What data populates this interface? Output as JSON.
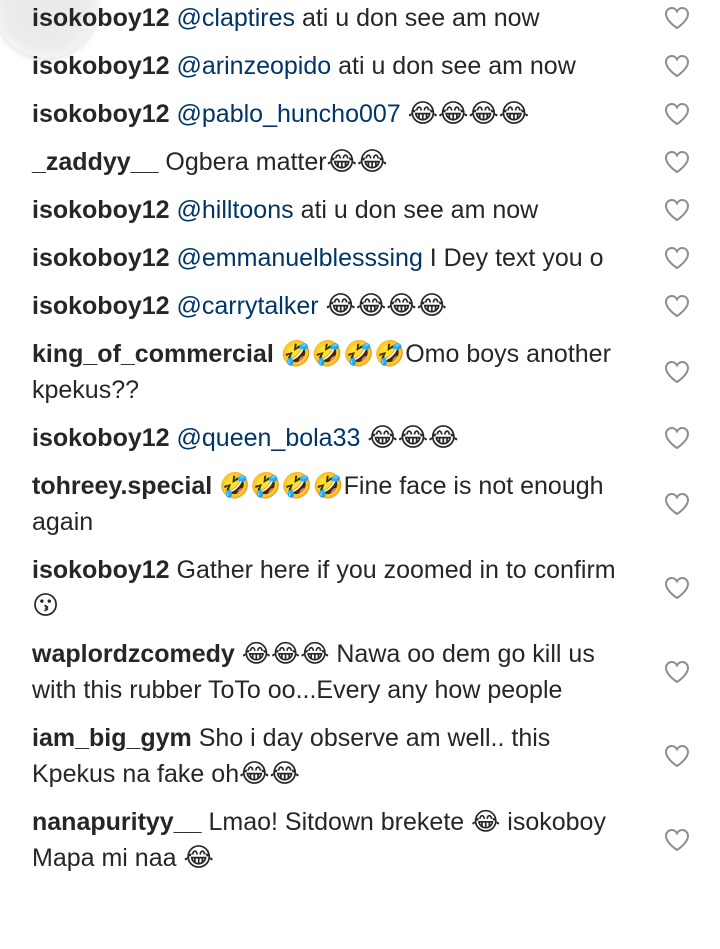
{
  "comments": [
    {
      "user": "isokoboy12",
      "mention": "@claptires",
      "text": " ati u don see am now",
      "emoji": ""
    },
    {
      "user": "isokoboy12",
      "mention": "@arinzeopido",
      "text": " ati u don see am now",
      "emoji": ""
    },
    {
      "user": "isokoboy12",
      "mention": "@pablo_huncho007",
      "text": " ",
      "emoji": "😂😂😂😂"
    },
    {
      "user": "_zaddyy__",
      "mention": "",
      "text": "Ogbera matter",
      "emoji": "😂😂"
    },
    {
      "user": "isokoboy12",
      "mention": "@hilltoons",
      "text": " ati u don see am now",
      "emoji": ""
    },
    {
      "user": "isokoboy12",
      "mention": "@emmanuelblesssing",
      "text": " I Dey text you o",
      "emoji": ""
    },
    {
      "user": "isokoboy12",
      "mention": "@carrytalker",
      "text": " ",
      "emoji": "😂😂😂😂"
    },
    {
      "user": "king_of_commercial",
      "mention": "",
      "text": "🤣🤣🤣🤣Omo boys another kpekus??",
      "emoji": ""
    },
    {
      "user": "isokoboy12",
      "mention": "@queen_bola33",
      "text": " ",
      "emoji": "😂😂😂"
    },
    {
      "user": "tohreey.special",
      "mention": "",
      "text": "🤣🤣🤣🤣Fine face is not enough again",
      "emoji": ""
    },
    {
      "user": "isokoboy12",
      "mention": "",
      "text": "Gather here if you zoomed in to confirm ",
      "emoji": "😗"
    },
    {
      "user": "waplordzcomedy",
      "mention": "",
      "text": "😂😂😂 Nawa oo dem go kill us with this rubber ToTo oo...Every any how people",
      "emoji": ""
    },
    {
      "user": "iam_big_gym",
      "mention": "",
      "text": "Sho i day observe am well.. this Kpekus na fake oh",
      "emoji": "😂😂"
    },
    {
      "user": "nanapurityy__",
      "mention": "",
      "text": "Lmao! Sitdown brekete 😂 isokoboy Mapa mi naa ",
      "emoji": "😂"
    }
  ],
  "icons": {
    "like": "heart-outline-icon"
  },
  "colors": {
    "username": "#262626",
    "mention": "#003569",
    "heart_stroke": "#8e8e8e"
  }
}
